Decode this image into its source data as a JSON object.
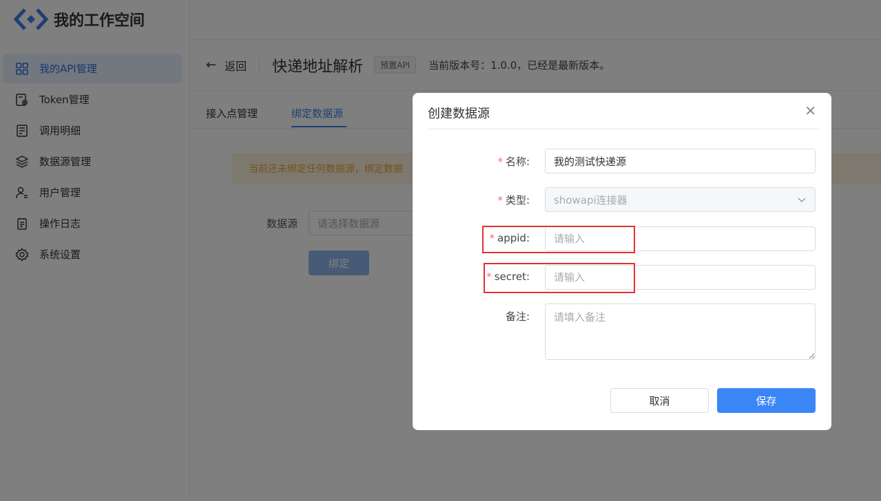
{
  "brand": {
    "name": "我的工作空间"
  },
  "sidebar": {
    "items": [
      {
        "label": "我的API管理",
        "icon": "grid-icon",
        "active": true
      },
      {
        "label": "Token管理",
        "icon": "token-gear-icon",
        "active": false
      },
      {
        "label": "调用明细",
        "icon": "receipt-icon",
        "active": false
      },
      {
        "label": "数据源管理",
        "icon": "layers-icon",
        "active": false
      },
      {
        "label": "用户管理",
        "icon": "user-list-icon",
        "active": false
      },
      {
        "label": "操作日志",
        "icon": "document-icon",
        "active": false
      },
      {
        "label": "系统设置",
        "icon": "gear-icon",
        "active": false
      }
    ]
  },
  "header": {
    "back_label": "返回",
    "title": "快递地址解析",
    "tag": "预置API",
    "version_text": "当前版本号：1.0.0，已经是最新版本。"
  },
  "tabs": [
    {
      "label": "接入点管理",
      "active": false
    },
    {
      "label": "绑定数据源",
      "active": true
    }
  ],
  "bind_panel": {
    "alert": "当前还未绑定任何数据源，绑定数据",
    "datasource_label": "数据源",
    "datasource_placeholder": "请选择数据源",
    "bind_button": "绑定"
  },
  "modal": {
    "title": "创建数据源",
    "close_icon": "close-icon",
    "fields": {
      "name": {
        "label": "名称:",
        "value": "我的测试快递源",
        "required": true
      },
      "type": {
        "label": "类型:",
        "value": "showapi连接器",
        "required": true
      },
      "appid": {
        "label": "appid:",
        "placeholder": "请输入",
        "required": true
      },
      "secret": {
        "label": "secret:",
        "placeholder": "请输入",
        "required": true
      },
      "remark": {
        "label": "备注:",
        "placeholder": "请填入备注",
        "required": false
      }
    },
    "cancel_label": "取消",
    "save_label": "保存",
    "required_mark": "*"
  },
  "colors": {
    "primary": "#3b86f7",
    "active_nav_bg": "#e6f0fe",
    "highlight": "#e03131",
    "required": "#f56c6c"
  }
}
